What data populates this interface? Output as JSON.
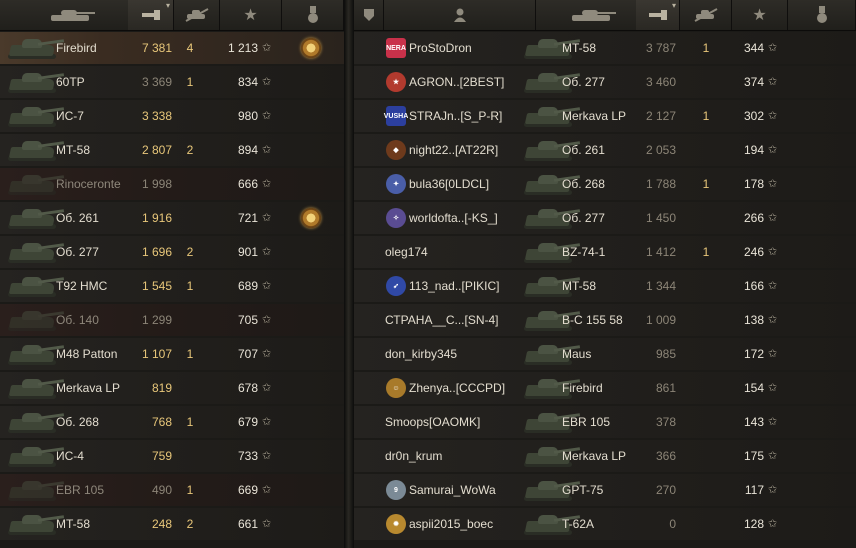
{
  "header": {
    "tank_icon": "tank-icon",
    "damage_icon": "damage-icon",
    "kills_icon": "kills-icon",
    "xp_icon": "star-icon",
    "medal_icon": "medal-icon",
    "squad_icon": "squad-icon",
    "player_icon": "player-icon",
    "sort_indicator": "▾"
  },
  "left_team": [
    {
      "name": "Firebird",
      "damage": "7 381",
      "kills": "4",
      "xp": "1 213",
      "medal": true,
      "me": true
    },
    {
      "name": "60TP",
      "damage": "3 369",
      "kills": "1",
      "xp": "834",
      "dim": true
    },
    {
      "name": "ИС-7",
      "damage": "3 338",
      "kills": "",
      "xp": "980"
    },
    {
      "name": "MT-58",
      "damage": "2 807",
      "kills": "2",
      "xp": "894"
    },
    {
      "name": "Rinoceronte",
      "damage": "1 998",
      "kills": "",
      "xp": "666",
      "dead": true
    },
    {
      "name": "Об. 261",
      "damage": "1 916",
      "kills": "",
      "xp": "721",
      "medal": true
    },
    {
      "name": "Об. 277",
      "damage": "1 696",
      "kills": "2",
      "xp": "901"
    },
    {
      "name": "T92 HMC",
      "damage": "1 545",
      "kills": "1",
      "xp": "689"
    },
    {
      "name": "Об. 140",
      "damage": "1 299",
      "kills": "",
      "xp": "705",
      "dead": true
    },
    {
      "name": "M48 Patton",
      "damage": "1 107",
      "kills": "1",
      "xp": "707"
    },
    {
      "name": "Merkava LP",
      "damage": "819",
      "kills": "",
      "xp": "678"
    },
    {
      "name": "Об. 268",
      "damage": "768",
      "kills": "1",
      "xp": "679"
    },
    {
      "name": "ИС-4",
      "damage": "759",
      "kills": "",
      "xp": "733"
    },
    {
      "name": "EBR 105",
      "damage": "490",
      "kills": "1",
      "xp": "669",
      "dead": true
    },
    {
      "name": "MT-58",
      "damage": "248",
      "kills": "2",
      "xp": "661"
    }
  ],
  "right_team": [
    {
      "player": "ProStoDron",
      "badge": "NERA",
      "badge_color": "#c9314a",
      "tank": "MT-58",
      "damage": "3 787",
      "kills": "1",
      "xp": "344"
    },
    {
      "player": "AGRON..[2BEST]",
      "badge": "★",
      "badge_color": "#b23a2e",
      "tank": "Об. 277",
      "damage": "3 460",
      "kills": "",
      "xp": "374"
    },
    {
      "player": "STRAJn..[S_P-R]",
      "badge": "VUSHA",
      "badge_color": "#2c3f9e",
      "tank": "Merkava LP",
      "damage": "2 127",
      "kills": "1",
      "xp": "302"
    },
    {
      "player": "night22..[AT22R]",
      "badge": "◆",
      "badge_color": "#6e3a1c",
      "tank": "Об. 261",
      "damage": "2 053",
      "kills": "",
      "xp": "194"
    },
    {
      "player": "bula36[0LDCL]",
      "badge": "✦",
      "badge_color": "#4a5ea8",
      "tank": "Об. 268",
      "damage": "1 788",
      "kills": "1",
      "xp": "178"
    },
    {
      "player": "worldofta..[-KS_]",
      "badge": "✧",
      "badge_color": "#5a4c92",
      "tank": "Об. 277",
      "damage": "1 450",
      "kills": "",
      "xp": "266"
    },
    {
      "player": "oleg174",
      "badge": "",
      "badge_color": "",
      "tank": "BZ-74-1",
      "damage": "1 412",
      "kills": "1",
      "xp": "246"
    },
    {
      "player": "113_nad..[PIKIC]",
      "badge": "➹",
      "badge_color": "#3049a6",
      "tank": "MT-58",
      "damage": "1 344",
      "kills": "",
      "xp": "166"
    },
    {
      "player": "СТРАНА__С...[SN-4]",
      "badge": "",
      "badge_color": "",
      "tank": "B-C 155 58",
      "damage": "1 009",
      "kills": "",
      "xp": "138"
    },
    {
      "player": "don_kirby345",
      "badge": "",
      "badge_color": "",
      "tank": "Maus",
      "damage": "985",
      "kills": "",
      "xp": "172"
    },
    {
      "player": "Zhenya..[CCCPD]",
      "badge": "☺",
      "badge_color": "#a87a2a",
      "tank": "Firebird",
      "damage": "861",
      "kills": "",
      "xp": "154"
    },
    {
      "player": "Smoops[OAOMK]",
      "badge": "",
      "badge_color": "",
      "tank": "EBR 105",
      "damage": "378",
      "kills": "",
      "xp": "143"
    },
    {
      "player": "dr0n_krum",
      "badge": "",
      "badge_color": "",
      "tank": "Merkava LP",
      "damage": "366",
      "kills": "",
      "xp": "175"
    },
    {
      "player": "Samurai_WoWa",
      "badge": "9",
      "badge_color": "#7b8a96",
      "tank": "GPT-75",
      "damage": "270",
      "kills": "",
      "xp": "117"
    },
    {
      "player": "aspii2015_boec",
      "badge": "✹",
      "badge_color": "#b8892f",
      "tank": "T-62A",
      "damage": "0",
      "kills": "",
      "xp": "128"
    }
  ]
}
